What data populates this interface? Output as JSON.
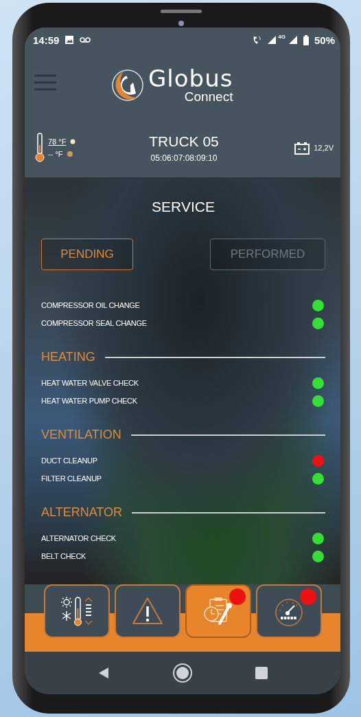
{
  "status_bar": {
    "time": "14:59",
    "network": "4G",
    "battery": "50%"
  },
  "header": {
    "logo_name": "Globus",
    "logo_sub": "Connect"
  },
  "truck": {
    "temp_inside": "78 °F",
    "temp_outside": "-- °F",
    "name": "TRUCK 05",
    "id": "05:06:07:08:09:10",
    "voltage": "12,2V"
  },
  "title": "SERVICE",
  "tabs": [
    {
      "label": "PENDING",
      "selected": true
    },
    {
      "label": "PERFORMED",
      "selected": false
    }
  ],
  "sections": [
    {
      "items": [
        {
          "name": "COMPRESSOR OIL CHANGE",
          "color": "#33e033"
        },
        {
          "name": "COMPRESSOR SEAL CHANGE",
          "color": "#33e033"
        }
      ]
    },
    {
      "title": "HEATING",
      "items": [
        {
          "name": "HEAT WATER VALVE CHECK",
          "color": "#33e033"
        },
        {
          "name": "HEAT WATER PUMP CHECK",
          "color": "#33e033"
        }
      ]
    },
    {
      "title": "VENTILATION",
      "items": [
        {
          "name": "DUCT CLEANUP",
          "color": "#ee1111"
        },
        {
          "name": "FILTER CLEANUP",
          "color": "#33e033"
        }
      ]
    },
    {
      "title": "ALTERNATOR",
      "items": [
        {
          "name": "ALTERNATOR CHECK",
          "color": "#33e033"
        },
        {
          "name": "BELT CHECK",
          "color": "#33e033"
        }
      ]
    }
  ],
  "bottom_tabs": [
    {
      "kind": "climate",
      "selected": false,
      "alert": false
    },
    {
      "kind": "warning",
      "selected": false,
      "alert": false
    },
    {
      "kind": "service",
      "selected": true,
      "alert": true
    },
    {
      "kind": "gauge",
      "selected": false,
      "alert": true
    }
  ]
}
